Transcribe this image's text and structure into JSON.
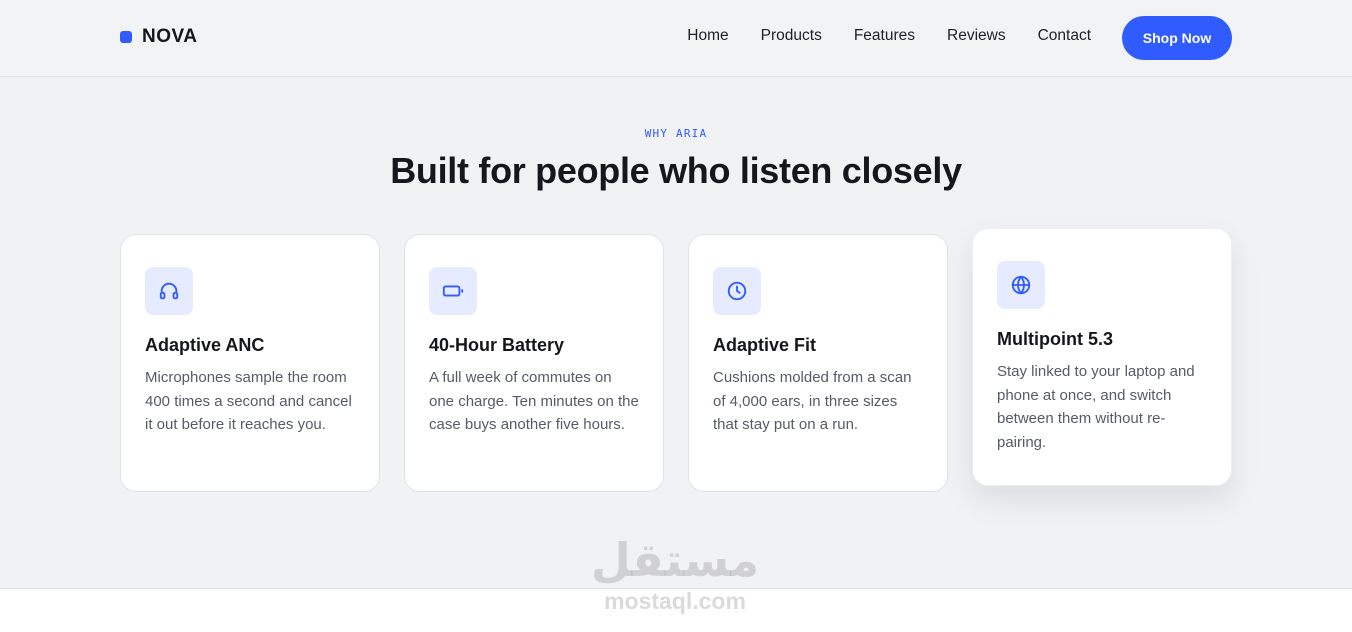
{
  "brand": {
    "name": "NOVA",
    "accent": "#2f5bff"
  },
  "nav": {
    "links": [
      "Home",
      "Products",
      "Features",
      "Reviews",
      "Contact"
    ],
    "cta_label": "Shop Now"
  },
  "section": {
    "eyebrow": "WHY ARIA",
    "title": "Built for people who listen closely"
  },
  "features": [
    {
      "icon": "headphones-icon",
      "title": "Adaptive ANC",
      "text": "Microphones sample the room 400 times a second and cancel it out before it reaches you."
    },
    {
      "icon": "battery-icon",
      "title": "40-Hour Battery",
      "text": "A full week of commutes on one charge. Ten minutes on the case buys another five hours."
    },
    {
      "icon": "clock-icon",
      "title": "Adaptive Fit",
      "text": "Cushions molded from a scan of 4,000 ears, in three sizes that stay put on a run."
    },
    {
      "icon": "globe-icon",
      "title": "Multipoint 5.3",
      "text": "Stay linked to your laptop and phone at once, and switch between them without re-pairing."
    }
  ],
  "watermark": {
    "arabic": "مستقل",
    "latin": "mostaql.com"
  }
}
